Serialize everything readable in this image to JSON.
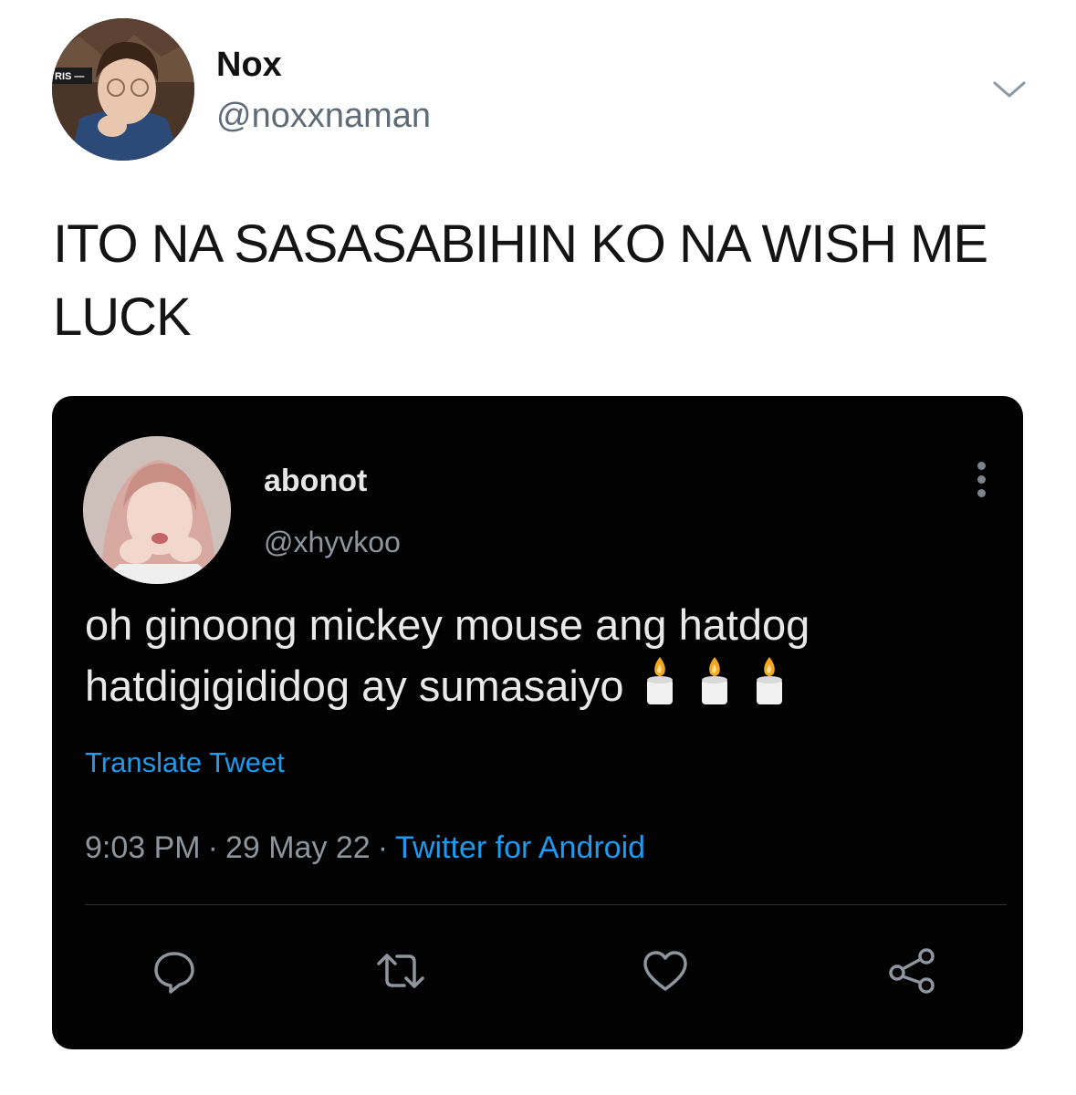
{
  "outer_tweet": {
    "display_name": "Nox",
    "handle": "@noxxnaman",
    "text": "ITO NA SASASABIHIN KO NA WISH ME LUCK",
    "avatar_badge": "RIS —",
    "menu_icon": "chevron-down-icon"
  },
  "quoted_screenshot": {
    "display_name": "abonot",
    "handle": "@xhyvkoo",
    "text": "oh ginoong mickey mouse ang hatdog hatdigigididog ay sumasaiyo",
    "emoji": [
      "candle",
      "candle",
      "candle"
    ],
    "translate_label": "Translate Tweet",
    "time": "9:03 PM",
    "date": "29 May 22",
    "separator": "·",
    "source": "Twitter for Android",
    "menu_icon": "more-vertical-icon",
    "actions": [
      {
        "icon": "reply-icon"
      },
      {
        "icon": "retweet-icon"
      },
      {
        "icon": "like-icon"
      },
      {
        "icon": "share-icon"
      }
    ],
    "colors": {
      "background": "#020202",
      "link": "#1d9bf0",
      "muted": "#8e959c"
    }
  }
}
